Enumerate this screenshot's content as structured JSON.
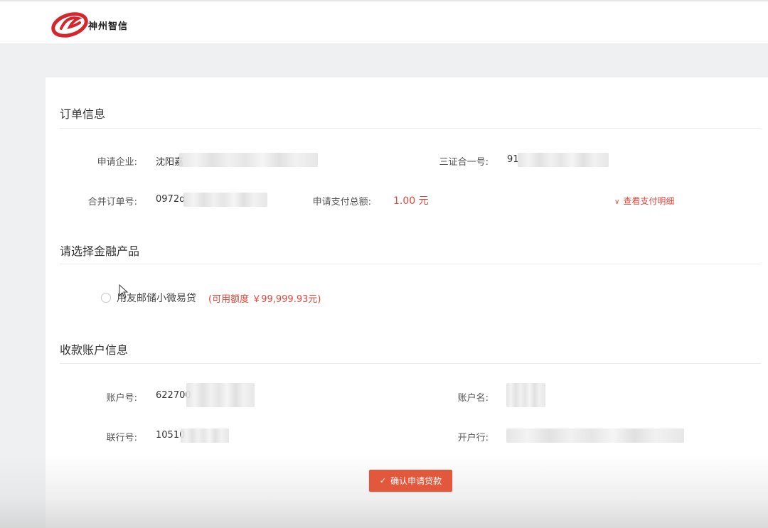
{
  "header": {
    "logo_text": "神州智信"
  },
  "order": {
    "title": "订单信息",
    "company_label": "申请企业:",
    "company_value": "沈阳嘉",
    "credit_code_label": "三证合一号:",
    "credit_code_value": "91",
    "merged_order_label": "合并订单号:",
    "merged_order_value": "0972d",
    "total_label": "申请支付总额:",
    "total_value": "1.00 元",
    "detail_link": "查看支付明细"
  },
  "product": {
    "title": "请选择金融产品",
    "name": "用友邮储小微易贷",
    "quota": "(可用额度 ￥99,999.93元)"
  },
  "account": {
    "title": "收款账户信息",
    "number_label": "账户号:",
    "number_value": "622700",
    "name_label": "账户名:",
    "bank_no_label": "联行号:",
    "bank_no_value": "10510",
    "bank_label": "开户行:"
  },
  "actions": {
    "confirm_label": "确认申请贷款"
  },
  "colors": {
    "accent": "#e2583d",
    "amount": "#e0453a"
  }
}
